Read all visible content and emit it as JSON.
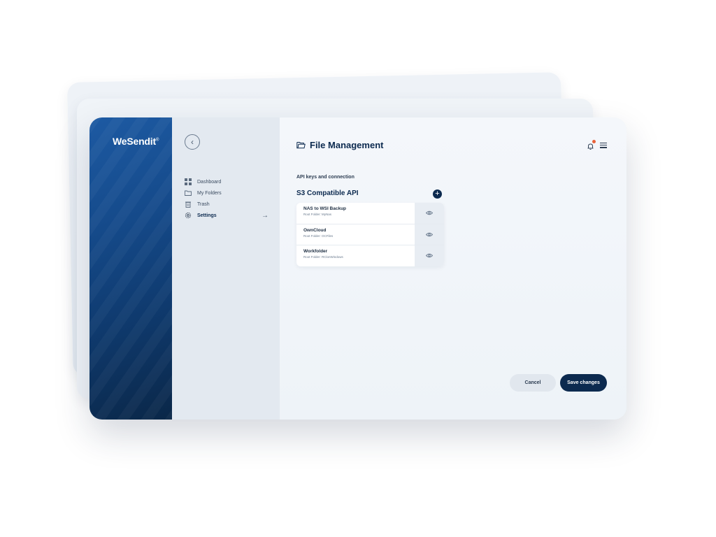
{
  "brand": {
    "name": "WeSendit",
    "mark": "®"
  },
  "nav": {
    "items": [
      {
        "label": "Dashboard",
        "icon": "grid-icon"
      },
      {
        "label": "My Folders",
        "icon": "folder-icon"
      },
      {
        "label": "Trash",
        "icon": "trash-icon"
      },
      {
        "label": "Settings",
        "icon": "gear-icon",
        "active": true
      }
    ],
    "active_arrow": "→"
  },
  "header": {
    "title": "File Management"
  },
  "section": {
    "label": "API keys and connection",
    "api_title": "S3 Compatible API",
    "add_symbol": "+"
  },
  "connections": [
    {
      "name": "NAS to WSI Backup",
      "root": "Root Folder: MyNas"
    },
    {
      "name": "OwnCloud",
      "root": "Root Folder: OCFiles"
    },
    {
      "name": "Workfolder",
      "root": "Root Folder: RClonWindows"
    }
  ],
  "actions": {
    "cancel_label": "Cancel",
    "save_label": "Save changes"
  },
  "colors": {
    "brand_dark": "#0c2a4f",
    "brand_blue": "#1d5aa3",
    "notification_dot": "#e8623a"
  }
}
